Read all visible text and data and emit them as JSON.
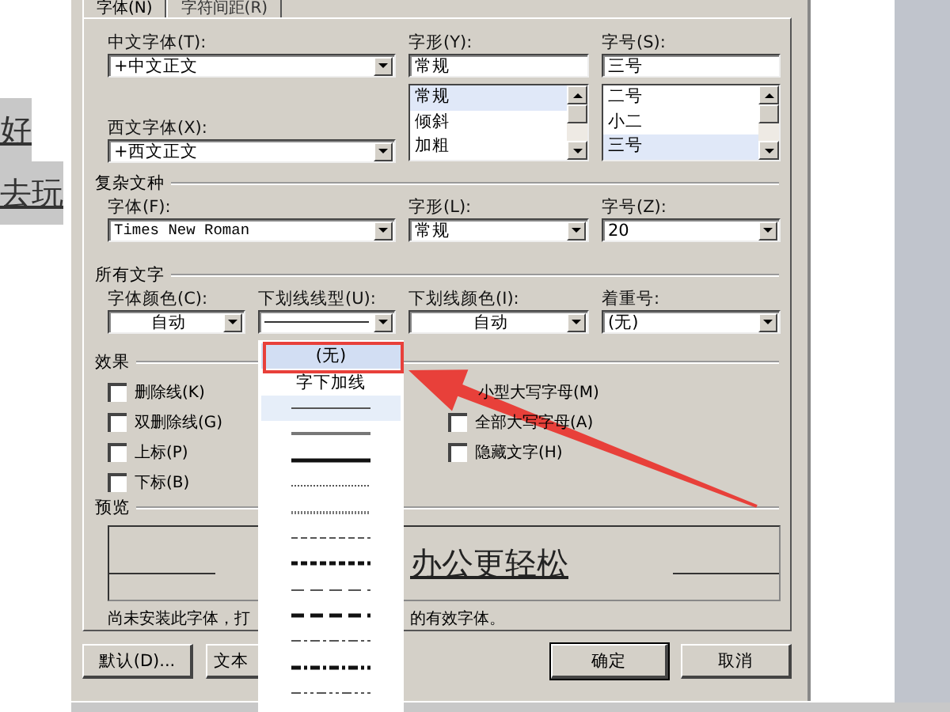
{
  "document": {
    "lines": [
      "好",
      "去玩"
    ]
  },
  "dialog": {
    "tabs": [
      {
        "label": "字体(N)",
        "selected": true
      },
      {
        "label": "字符间距(R)",
        "selected": false
      }
    ],
    "chinese_font": {
      "label": "中文字体(T):",
      "value": "+中文正文"
    },
    "western_font": {
      "label": "西文字体(X):",
      "value": "+西文正文"
    },
    "font_style": {
      "label": "字形(Y):",
      "value": "常规",
      "options": [
        {
          "text": "常规",
          "selected": true
        },
        {
          "text": "倾斜",
          "selected": false
        },
        {
          "text": "加粗",
          "selected": false
        }
      ]
    },
    "font_size": {
      "label": "字号(S):",
      "value": "三号",
      "options": [
        {
          "text": "二号",
          "selected": false
        },
        {
          "text": "小二",
          "selected": false
        },
        {
          "text": "三号",
          "selected": true
        }
      ]
    },
    "complex_script": {
      "heading": "复杂文种",
      "font": {
        "label": "字体(F):",
        "value": "Times New Roman"
      },
      "style": {
        "label": "字形(L):",
        "value": "常规"
      },
      "size": {
        "label": "字号(Z):",
        "value": "20"
      }
    },
    "all_text": {
      "heading": "所有文字",
      "font_color": {
        "label": "字体颜色(C):",
        "value": "自动"
      },
      "underline_style": {
        "label": "下划线线型(U):"
      },
      "underline_color": {
        "label": "下划线颜色(I):",
        "value": "自动"
      },
      "emphasis": {
        "label": "着重号:",
        "value": "(无)"
      }
    },
    "effects": {
      "heading": "效果",
      "left": [
        {
          "label": "删除线(K)",
          "checked": false
        },
        {
          "label": "双删除线(G)",
          "checked": false
        },
        {
          "label": "上标(P)",
          "checked": false
        },
        {
          "label": "下标(B)",
          "checked": false
        }
      ],
      "right": [
        {
          "label": "小型大写字母(M)"
        },
        {
          "label": "全部大写字母(A)",
          "checked": false
        },
        {
          "label": "隐藏文字(H)",
          "checked": false
        }
      ]
    },
    "preview": {
      "heading": "预览",
      "sample": "办公更轻松",
      "note_start": "尚未安装此字体，打",
      "note_end": "的有效字体。"
    },
    "buttons": [
      {
        "label": "默认(D)...",
        "default": false
      },
      {
        "label": "文本",
        "default": false
      },
      {
        "label": "确定",
        "default": true
      },
      {
        "label": "取消",
        "default": false
      }
    ]
  },
  "underline_dropdown": {
    "items": [
      {
        "kind": "text",
        "text": "(无)",
        "selected": true,
        "hovered": false
      },
      {
        "kind": "text",
        "text": "字下加线",
        "selected": false,
        "hovered": false
      },
      {
        "kind": "solid-thin",
        "selected": false,
        "hovered": true
      },
      {
        "kind": "solid-medium",
        "selected": false,
        "hovered": false
      },
      {
        "kind": "solid-thick",
        "selected": false,
        "hovered": false
      },
      {
        "kind": "dotted-thin",
        "selected": false,
        "hovered": false
      },
      {
        "kind": "dotted-medium",
        "selected": false,
        "hovered": false
      },
      {
        "kind": "dashed-thin",
        "selected": false,
        "hovered": false
      },
      {
        "kind": "dashed-thick",
        "selected": false,
        "hovered": false
      },
      {
        "kind": "longdash-thin",
        "selected": false,
        "hovered": false
      },
      {
        "kind": "longdash-thick",
        "selected": false,
        "hovered": false
      },
      {
        "kind": "dashdot-thin",
        "selected": false,
        "hovered": false
      },
      {
        "kind": "dashdot-thick",
        "selected": false,
        "hovered": false
      },
      {
        "kind": "dashdotdot-thin",
        "selected": false,
        "hovered": false
      }
    ]
  }
}
